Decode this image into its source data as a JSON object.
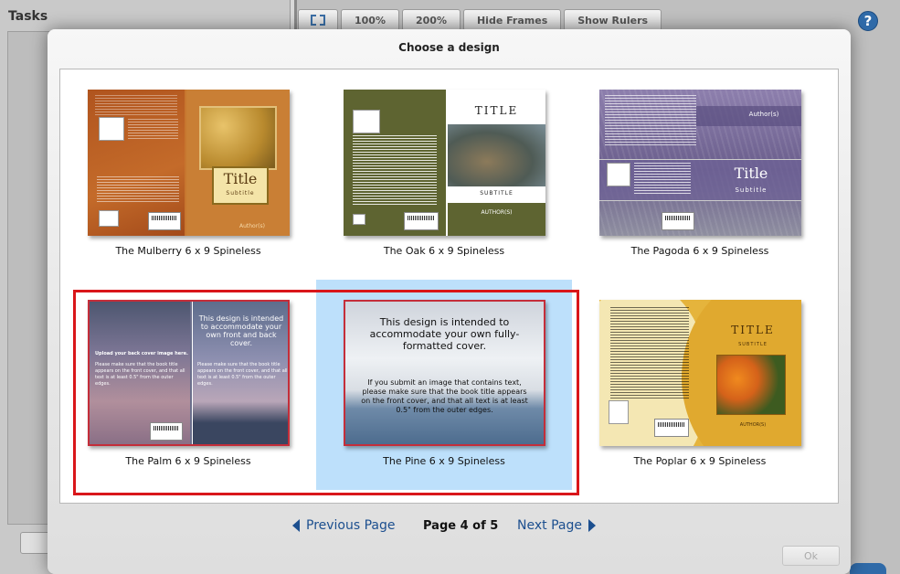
{
  "app": {
    "tasks_title": "Tasks",
    "toolbar": {
      "zoom_100": "100%",
      "zoom_200": "200%",
      "hide_frames": "Hide Frames",
      "show_rulers": "Show Rulers"
    },
    "help_label": "?"
  },
  "dialog": {
    "title": "Choose a design",
    "designs": [
      {
        "label": "The Mulberry 6 x 9 Spineless",
        "cover_title": "Title",
        "cover_subtitle": "Subtitle",
        "cover_author": "Author(s)",
        "selected": false
      },
      {
        "label": "The Oak 6 x 9 Spineless",
        "cover_title": "TITLE",
        "cover_subtitle": "SUBTITLE",
        "cover_author": "AUTHOR(S)",
        "selected": false
      },
      {
        "label": "The Pagoda 6 x 9 Spineless",
        "cover_title": "Title",
        "cover_subtitle": "Subtitle",
        "cover_author": "Author(s)",
        "selected": false
      },
      {
        "label": "The Palm 6 x 9 Spineless",
        "cover_heading": "This design is intended to accommodate your own front and back cover.",
        "back_heading": "Upload your back cover image here.",
        "back_note": "Please make sure that the book title appears on the front cover, and that all text is at least 0.5\" from the outer edges.",
        "front_note": "Please make sure that the book title appears on the front cover, and that all text is at least 0.5\" from the outer edges.",
        "selected": false
      },
      {
        "label": "The Pine 6 x 9 Spineless",
        "cover_heading": "This design is intended to accommodate your own fully-formatted cover.",
        "cover_note": "If you submit an image that contains text, please make sure that the book title appears on the front cover, and that all text is at least 0.5\" from the outer edges.",
        "selected": true
      },
      {
        "label": "The Poplar 6 x 9 Spineless",
        "cover_title": "TITLE",
        "cover_subtitle": "SUBTITLE",
        "cover_author": "AUTHOR(S)",
        "selected": false
      }
    ],
    "pagination": {
      "previous": "Previous Page",
      "indicator": "Page 4 of 5",
      "next": "Next Page"
    },
    "ok_label": "Ok"
  },
  "colors": {
    "link": "#1c4f8f",
    "selection_bg": "#bde0fb",
    "highlight_outline": "#d9161a"
  }
}
